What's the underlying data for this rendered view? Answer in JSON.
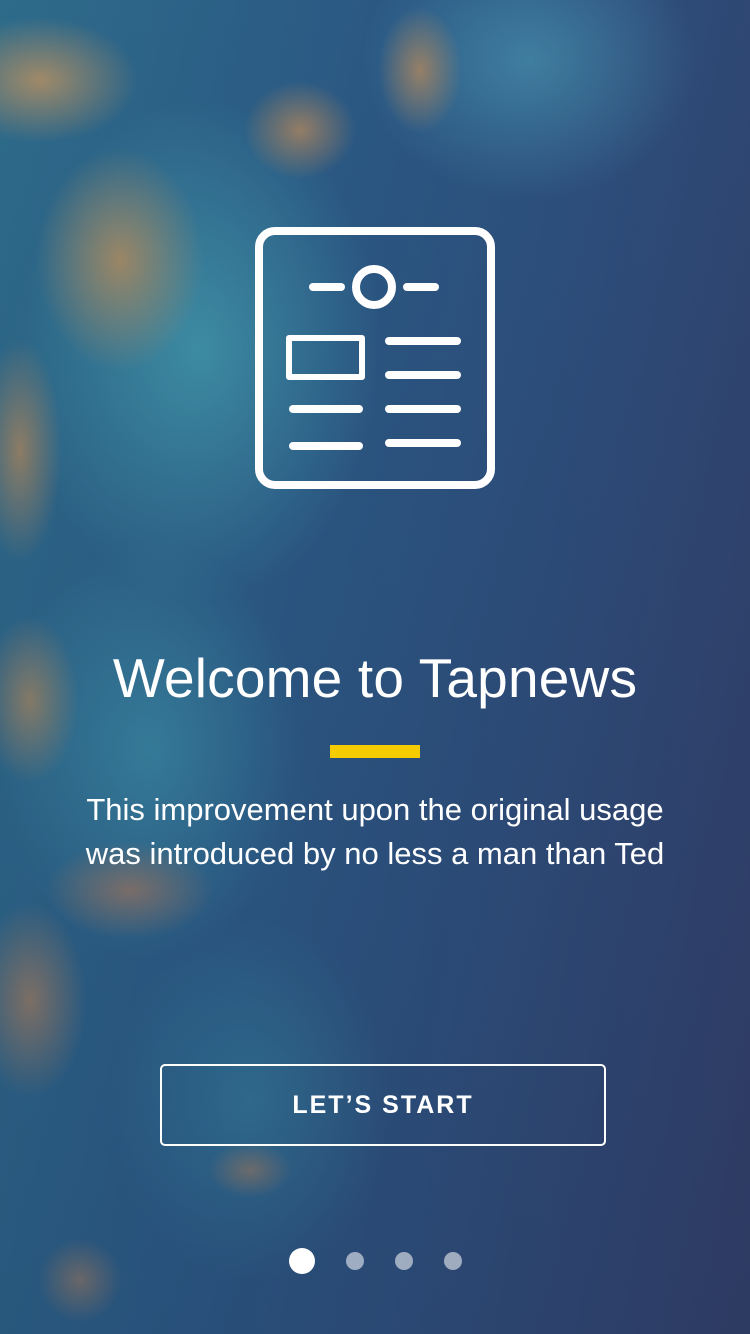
{
  "onboarding": {
    "title": "Welcome to Tapnews",
    "description": "This improvement upon the original usage was introduced by no less a man than Ted",
    "start_button_label": "LET’S START",
    "hero_icon": "news-article-icon",
    "accent_color": "#f5cc00",
    "pager": {
      "total_pages": 4,
      "current_page": 1
    }
  }
}
